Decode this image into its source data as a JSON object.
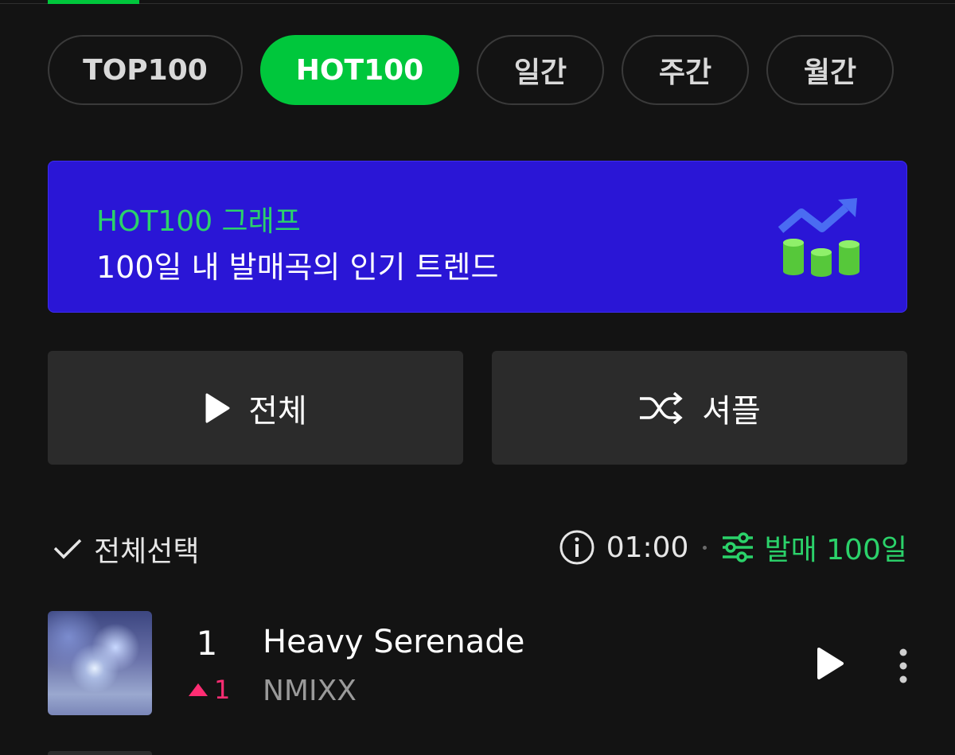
{
  "tabs": [
    {
      "label": "TOP100",
      "active": false
    },
    {
      "label": "HOT100",
      "active": true
    },
    {
      "label": "일간",
      "active": false
    },
    {
      "label": "주간",
      "active": false
    },
    {
      "label": "월간",
      "active": false
    }
  ],
  "banner": {
    "title": "HOT100 그래프",
    "subtitle": "100일 내 발매곡의 인기 트렌드",
    "icon": "trend-chart-icon",
    "background_color": "#2a16d6"
  },
  "actions": {
    "play_all_label": "전체",
    "shuffle_label": "셔플"
  },
  "list_header": {
    "select_all_label": "전체선택",
    "time": "01:00",
    "filter_label": "발매 100일"
  },
  "songs": [
    {
      "rank": "1",
      "rank_change": "1",
      "rank_direction": "up",
      "title": "Heavy Serenade",
      "artist": "NMIXX"
    }
  ],
  "colors": {
    "accent": "#00c73c",
    "accent_text": "#2bd26a",
    "rank_up": "#ff2d73",
    "background": "#131313"
  }
}
